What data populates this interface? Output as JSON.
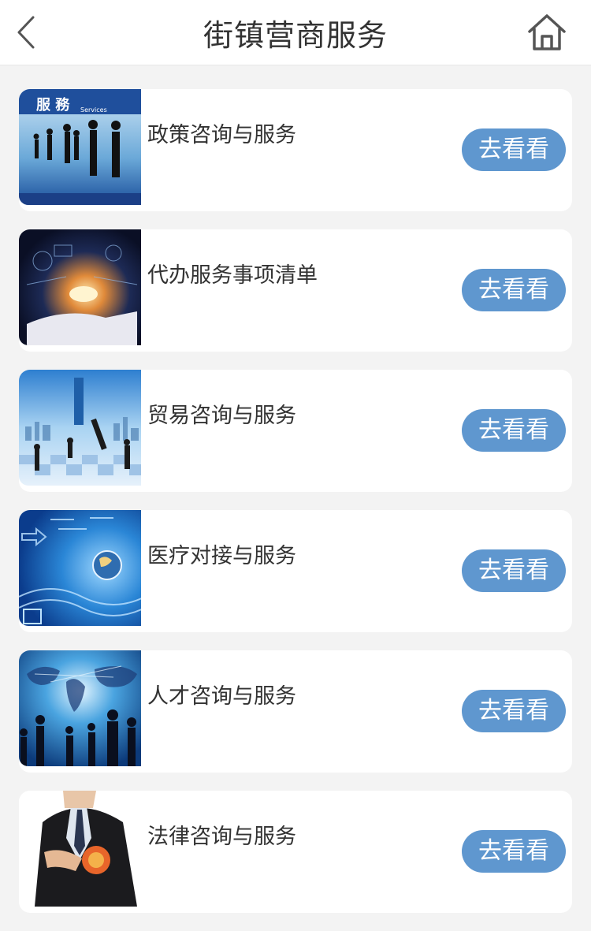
{
  "header": {
    "title": "街镇营商服务"
  },
  "services": [
    {
      "label": "政策咨询与服务",
      "button": "去看看",
      "image_badge": "服 務",
      "image_badge_sub": "Services"
    },
    {
      "label": "代办服务事项清单",
      "button": "去看看"
    },
    {
      "label": "贸易咨询与服务",
      "button": "去看看"
    },
    {
      "label": "医疗对接与服务",
      "button": "去看看"
    },
    {
      "label": "人才咨询与服务",
      "button": "去看看"
    },
    {
      "label": "法律咨询与服务",
      "button": "去看看"
    }
  ],
  "colors": {
    "button": "#5f97cf",
    "background": "#f3f3f3",
    "card": "#ffffff",
    "text": "#333333"
  },
  "icons": {
    "back": "chevron-left-icon",
    "home": "home-icon"
  }
}
